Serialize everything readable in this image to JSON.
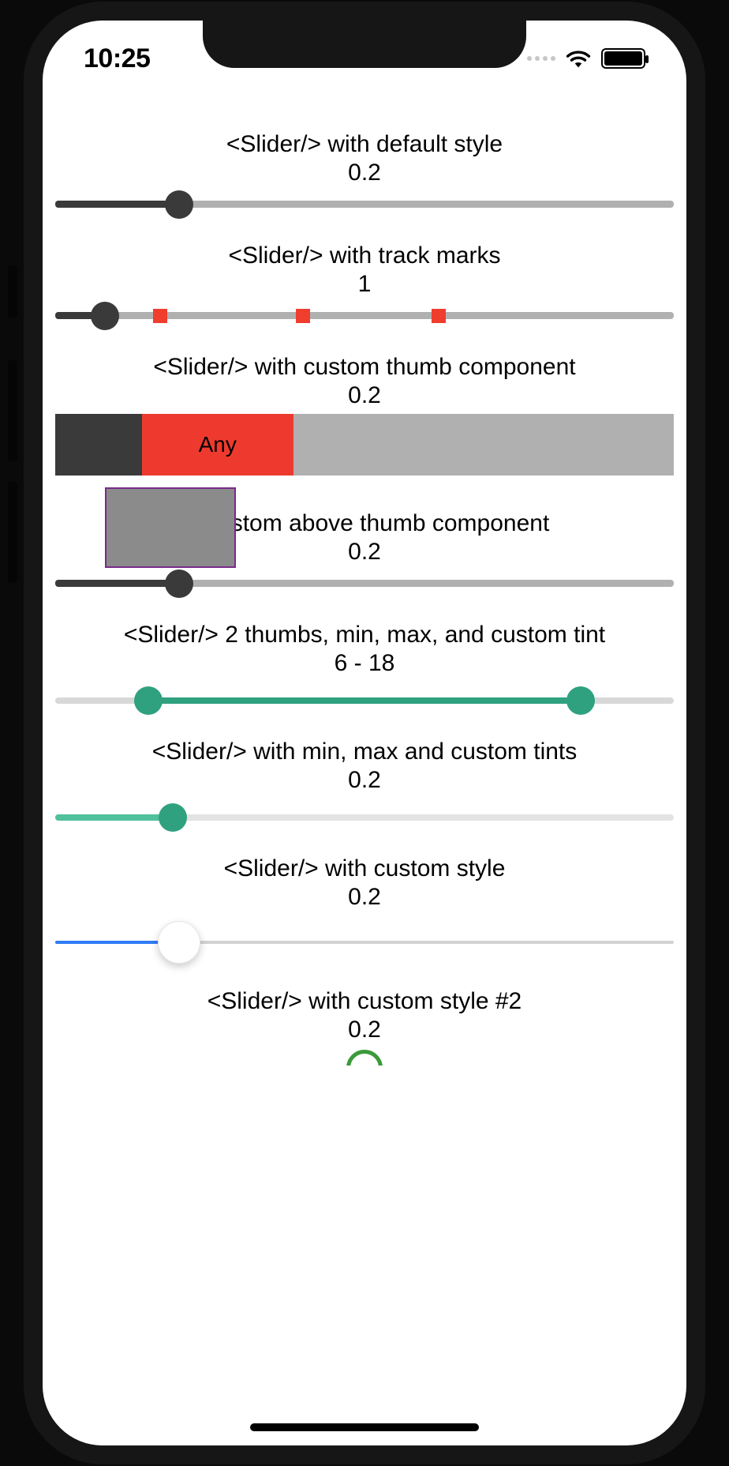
{
  "status": {
    "time": "10:25"
  },
  "sliders": {
    "s1": {
      "title": "<Slider/> with default style",
      "value": "0.2",
      "pct": 20
    },
    "s2": {
      "title": "<Slider/> with track marks",
      "value": "1",
      "pct": 8,
      "marks_pct": [
        17,
        40,
        62
      ]
    },
    "s3": {
      "title": "<Slider/> with custom thumb component",
      "value": "0.2",
      "thumb_label": "Any",
      "pct": 20
    },
    "s4": {
      "title": "th custom above thumb component",
      "value": "0.2",
      "pct": 20
    },
    "s5": {
      "title": "<Slider/> 2 thumbs, min, max, and custom tint",
      "value": "6 - 18",
      "lo_pct": 15,
      "hi_pct": 85
    },
    "s6": {
      "title": "<Slider/> with min, max and custom tints",
      "value": "0.2",
      "pct": 19
    },
    "s7": {
      "title": "<Slider/> with custom style",
      "value": "0.2",
      "pct": 20
    },
    "s8": {
      "title": "<Slider/> with custom style #2",
      "value": "0.2"
    }
  },
  "colors": {
    "track_grey": "#b0b0b0",
    "dark_grey": "#3a3a3a",
    "red": "#ee3a2e",
    "red_mark": "#ef3d2e",
    "purple_border": "#7a2a8a",
    "teal": "#2fa17f",
    "teal_light": "#50c19c",
    "blue": "#2f7cf6",
    "green_arc": "#3a9a3a"
  }
}
